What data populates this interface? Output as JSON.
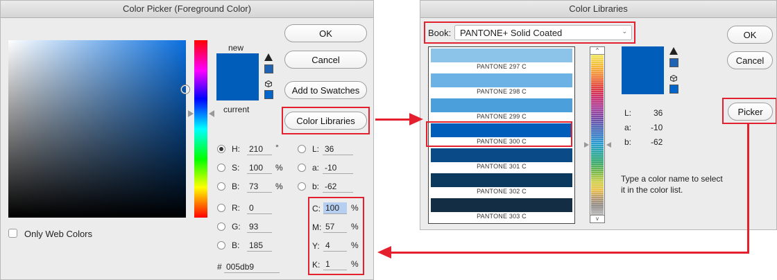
{
  "color_picker": {
    "title": "Color Picker (Foreground Color)",
    "new_label": "new",
    "current_label": "current",
    "current_color": "#005db9",
    "ok_label": "OK",
    "cancel_label": "Cancel",
    "add_swatches_label": "Add to Swatches",
    "color_libraries_label": "Color Libraries",
    "only_web_colors_label": "Only Web Colors",
    "hsb": [
      {
        "label": "H:",
        "value": "210",
        "unit": "°",
        "selected": true
      },
      {
        "label": "S:",
        "value": "100",
        "unit": "%",
        "selected": false
      },
      {
        "label": "B:",
        "value": "73",
        "unit": "%",
        "selected": false
      }
    ],
    "rgb": [
      {
        "label": "R:",
        "value": "0"
      },
      {
        "label": "G:",
        "value": "93"
      },
      {
        "label": "B:",
        "value": "185"
      }
    ],
    "lab": [
      {
        "label": "L:",
        "value": "36"
      },
      {
        "label": "a:",
        "value": "-10"
      },
      {
        "label": "b:",
        "value": "-62"
      }
    ],
    "cmyk": [
      {
        "label": "C:",
        "value": "100",
        "unit": "%"
      },
      {
        "label": "M:",
        "value": "57",
        "unit": "%"
      },
      {
        "label": "Y:",
        "value": "4",
        "unit": "%"
      },
      {
        "label": "K:",
        "value": "1",
        "unit": "%"
      }
    ],
    "hex_label": "#",
    "hex_value": "005db9"
  },
  "color_libraries": {
    "title": "Color Libraries",
    "book_label": "Book:",
    "book_value": "PANTONE+ Solid Coated",
    "ok_label": "OK",
    "cancel_label": "Cancel",
    "picker_label": "Picker",
    "swatches": [
      {
        "name": "PANTONE 297 C",
        "color": "#8cc3e8"
      },
      {
        "name": "PANTONE 298 C",
        "color": "#6cb2e4"
      },
      {
        "name": "PANTONE 299 C",
        "color": "#4ba0dc"
      },
      {
        "name": "PANTONE 300 C",
        "color": "#005db9"
      },
      {
        "name": "PANTONE 301 C",
        "color": "#0a4a87"
      },
      {
        "name": "PANTONE 302 C",
        "color": "#0c3a5e"
      },
      {
        "name": "PANTONE 303 C",
        "color": "#132e44"
      }
    ],
    "lab": [
      {
        "label": "L:",
        "value": "36"
      },
      {
        "label": "a:",
        "value": "-10"
      },
      {
        "label": "b:",
        "value": "-62"
      }
    ],
    "hint": "Type a color name to select it in the color list."
  },
  "colors": {
    "highlight": "#e5202e"
  }
}
